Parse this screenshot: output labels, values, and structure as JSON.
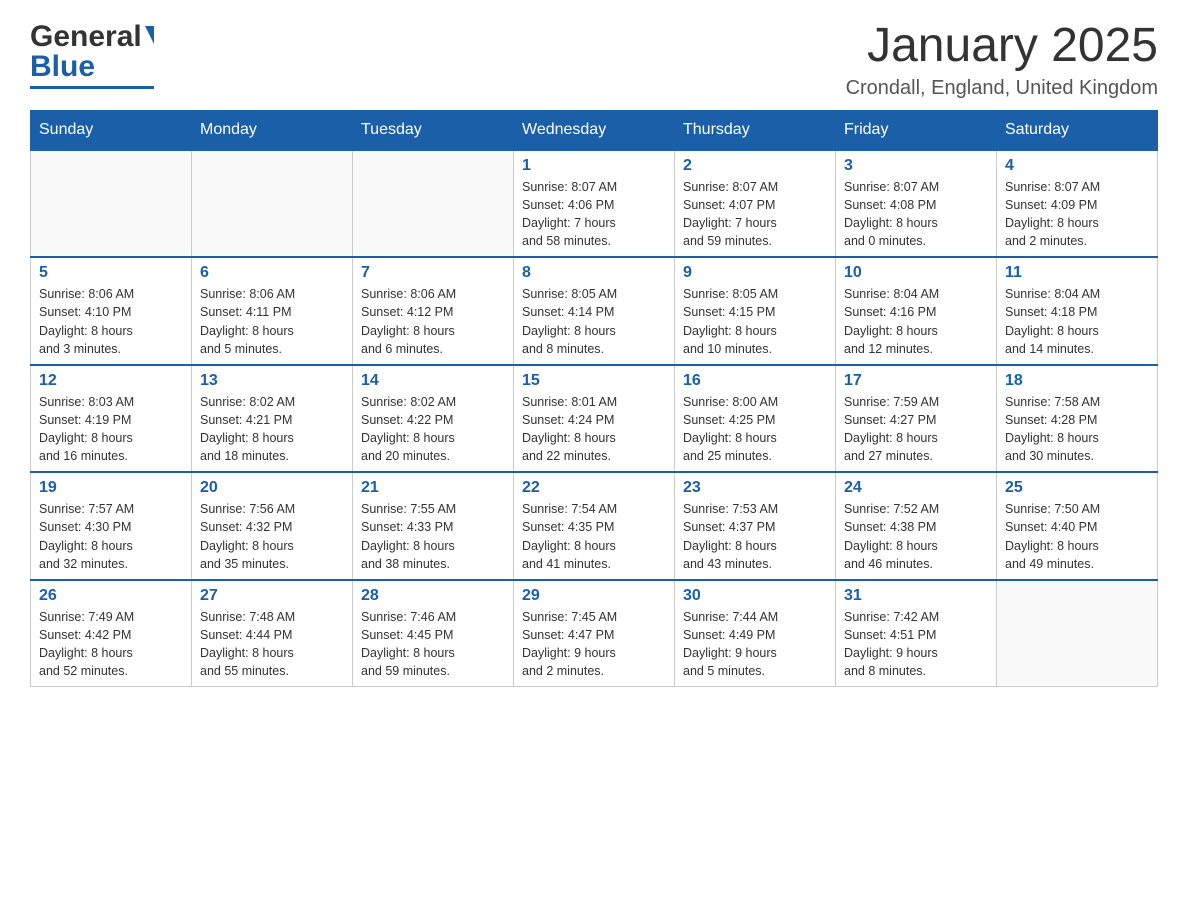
{
  "logo": {
    "general": "General",
    "blue": "Blue"
  },
  "title": "January 2025",
  "subtitle": "Crondall, England, United Kingdom",
  "days_of_week": [
    "Sunday",
    "Monday",
    "Tuesday",
    "Wednesday",
    "Thursday",
    "Friday",
    "Saturday"
  ],
  "weeks": [
    [
      {
        "day": "",
        "info": ""
      },
      {
        "day": "",
        "info": ""
      },
      {
        "day": "",
        "info": ""
      },
      {
        "day": "1",
        "info": "Sunrise: 8:07 AM\nSunset: 4:06 PM\nDaylight: 7 hours\nand 58 minutes."
      },
      {
        "day": "2",
        "info": "Sunrise: 8:07 AM\nSunset: 4:07 PM\nDaylight: 7 hours\nand 59 minutes."
      },
      {
        "day": "3",
        "info": "Sunrise: 8:07 AM\nSunset: 4:08 PM\nDaylight: 8 hours\nand 0 minutes."
      },
      {
        "day": "4",
        "info": "Sunrise: 8:07 AM\nSunset: 4:09 PM\nDaylight: 8 hours\nand 2 minutes."
      }
    ],
    [
      {
        "day": "5",
        "info": "Sunrise: 8:06 AM\nSunset: 4:10 PM\nDaylight: 8 hours\nand 3 minutes."
      },
      {
        "day": "6",
        "info": "Sunrise: 8:06 AM\nSunset: 4:11 PM\nDaylight: 8 hours\nand 5 minutes."
      },
      {
        "day": "7",
        "info": "Sunrise: 8:06 AM\nSunset: 4:12 PM\nDaylight: 8 hours\nand 6 minutes."
      },
      {
        "day": "8",
        "info": "Sunrise: 8:05 AM\nSunset: 4:14 PM\nDaylight: 8 hours\nand 8 minutes."
      },
      {
        "day": "9",
        "info": "Sunrise: 8:05 AM\nSunset: 4:15 PM\nDaylight: 8 hours\nand 10 minutes."
      },
      {
        "day": "10",
        "info": "Sunrise: 8:04 AM\nSunset: 4:16 PM\nDaylight: 8 hours\nand 12 minutes."
      },
      {
        "day": "11",
        "info": "Sunrise: 8:04 AM\nSunset: 4:18 PM\nDaylight: 8 hours\nand 14 minutes."
      }
    ],
    [
      {
        "day": "12",
        "info": "Sunrise: 8:03 AM\nSunset: 4:19 PM\nDaylight: 8 hours\nand 16 minutes."
      },
      {
        "day": "13",
        "info": "Sunrise: 8:02 AM\nSunset: 4:21 PM\nDaylight: 8 hours\nand 18 minutes."
      },
      {
        "day": "14",
        "info": "Sunrise: 8:02 AM\nSunset: 4:22 PM\nDaylight: 8 hours\nand 20 minutes."
      },
      {
        "day": "15",
        "info": "Sunrise: 8:01 AM\nSunset: 4:24 PM\nDaylight: 8 hours\nand 22 minutes."
      },
      {
        "day": "16",
        "info": "Sunrise: 8:00 AM\nSunset: 4:25 PM\nDaylight: 8 hours\nand 25 minutes."
      },
      {
        "day": "17",
        "info": "Sunrise: 7:59 AM\nSunset: 4:27 PM\nDaylight: 8 hours\nand 27 minutes."
      },
      {
        "day": "18",
        "info": "Sunrise: 7:58 AM\nSunset: 4:28 PM\nDaylight: 8 hours\nand 30 minutes."
      }
    ],
    [
      {
        "day": "19",
        "info": "Sunrise: 7:57 AM\nSunset: 4:30 PM\nDaylight: 8 hours\nand 32 minutes."
      },
      {
        "day": "20",
        "info": "Sunrise: 7:56 AM\nSunset: 4:32 PM\nDaylight: 8 hours\nand 35 minutes."
      },
      {
        "day": "21",
        "info": "Sunrise: 7:55 AM\nSunset: 4:33 PM\nDaylight: 8 hours\nand 38 minutes."
      },
      {
        "day": "22",
        "info": "Sunrise: 7:54 AM\nSunset: 4:35 PM\nDaylight: 8 hours\nand 41 minutes."
      },
      {
        "day": "23",
        "info": "Sunrise: 7:53 AM\nSunset: 4:37 PM\nDaylight: 8 hours\nand 43 minutes."
      },
      {
        "day": "24",
        "info": "Sunrise: 7:52 AM\nSunset: 4:38 PM\nDaylight: 8 hours\nand 46 minutes."
      },
      {
        "day": "25",
        "info": "Sunrise: 7:50 AM\nSunset: 4:40 PM\nDaylight: 8 hours\nand 49 minutes."
      }
    ],
    [
      {
        "day": "26",
        "info": "Sunrise: 7:49 AM\nSunset: 4:42 PM\nDaylight: 8 hours\nand 52 minutes."
      },
      {
        "day": "27",
        "info": "Sunrise: 7:48 AM\nSunset: 4:44 PM\nDaylight: 8 hours\nand 55 minutes."
      },
      {
        "day": "28",
        "info": "Sunrise: 7:46 AM\nSunset: 4:45 PM\nDaylight: 8 hours\nand 59 minutes."
      },
      {
        "day": "29",
        "info": "Sunrise: 7:45 AM\nSunset: 4:47 PM\nDaylight: 9 hours\nand 2 minutes."
      },
      {
        "day": "30",
        "info": "Sunrise: 7:44 AM\nSunset: 4:49 PM\nDaylight: 9 hours\nand 5 minutes."
      },
      {
        "day": "31",
        "info": "Sunrise: 7:42 AM\nSunset: 4:51 PM\nDaylight: 9 hours\nand 8 minutes."
      },
      {
        "day": "",
        "info": ""
      }
    ]
  ]
}
